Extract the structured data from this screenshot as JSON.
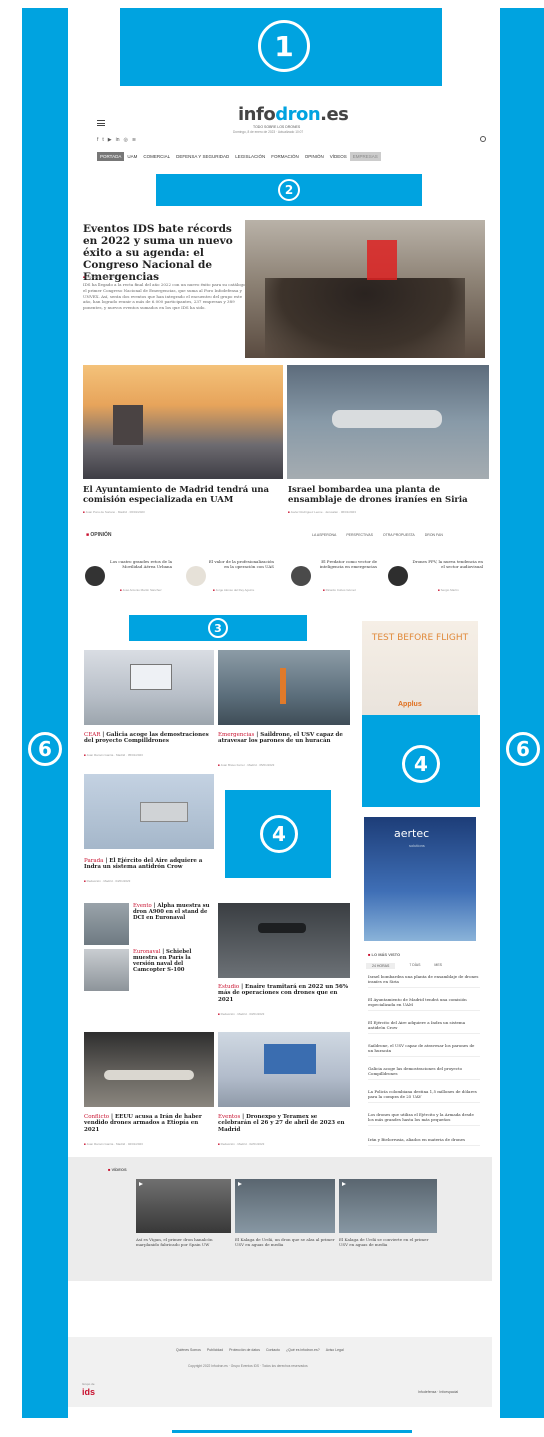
{
  "slots": {
    "top_banner_number": "1",
    "nav_banner_number": "2",
    "mid_banner_number": "3",
    "side_banner_number": "4",
    "center_banner_number": "4",
    "left_skyscraper_number": "6",
    "right_skyscraper_number": "6"
  },
  "header": {
    "logo_part1": "info",
    "logo_part2": "dron",
    "logo_part3": ".es",
    "tagline": "TODO SOBRE LOS DRONES",
    "date_line": "Domingo, 8 de enero de 2023 · Actualizado 10:07"
  },
  "nav": {
    "items": [
      "PORTADA",
      "UAM",
      "COMERCIAL",
      "DEFENSA Y SEGURIDAD",
      "LEGISLACIÓN",
      "FORMACIÓN",
      "OPINIÓN",
      "VÍDEOS",
      "EMPRESAS"
    ]
  },
  "lead": {
    "headline": "Eventos IDS bate récords en 2022 y suma un nuevo éxito a su agenda: el Congreso Nacional de Emergencias",
    "meta": "Redacción · 08/01/2023",
    "summary": "IDS ha llegado a la recta final del año 2022 con un nuevo éxito para su catálogo, el primer Congreso Nacional de Emergencias, que suma al Foro Infodefensa y UNVEX. Así, serán dos eventos que han integrado el encuentro del grupo este año, han logrado reunir a más de 6.000 participantes, 237 empresas y 389 ponentes, y nuevos eventos sumados en los que IDS ha sido."
  },
  "second_row": [
    {
      "headline": "El Ayuntamiento de Madrid tendrá una comisión especializada en UAM",
      "meta": "Juan Pons de Soriano · Madrid · 06/01/2023"
    },
    {
      "headline": "Israel bombardea una planta de ensamblaje de drones iraníes en Siria",
      "meta": "Javier Rodríguez Leone · Jerusalén · 06/01/2023"
    }
  ],
  "opinion": {
    "section_label": "OPINIÓN",
    "tabs": [
      "LA ASPERONA",
      "PERSPECTIVAS",
      "OTRA PROPUESTA",
      "DRON FAN"
    ],
    "items": [
      {
        "title": "Los cuatro grandes retos de la Movilidad Aérea Urbana",
        "author": "José Antonio Martín Sánchez"
      },
      {
        "title": "El valor de la profesionalización en la operación con UAS",
        "author": "Jorge Alonso del Rey Aguirre"
      },
      {
        "title": "El Predator como vector de inteligencia en emergencias",
        "author": "Ricardo Cobos Gómez"
      },
      {
        "title": "Drones FPV, la nueva tendencia en el sector audiovisual",
        "author": "Sergio Martín"
      }
    ]
  },
  "grid": [
    {
      "kicker": "CEAR",
      "headline": "Galicia acoge las demostraciones del proyecto Compilldrones",
      "meta": "Juan Ramón Garcia · Madrid · 05/01/2023"
    },
    {
      "kicker": "Emergencias",
      "headline": "Saildrone, el USV capaz de atravesar los parones de un huracán",
      "meta": "Juan Bravo Ferrer · Madrid · 05/01/2023"
    },
    {
      "kicker": "Parada",
      "headline": "El Ejército del Aire adquiere a Indra un sistema antidrón Crow",
      "meta": "Redacción · Madrid · 04/01/2023"
    },
    {
      "kicker": "Evento",
      "headline": "Alpha muestra su dron A900 en el stand de DCI en Euronaval",
      "meta": ""
    },
    {
      "kicker": "Euronaval",
      "headline": "Schiebel muestra en París la versión naval del Camcopter S-100",
      "meta": ""
    },
    {
      "kicker": "Estudio",
      "headline": "Enaire tramitará en 2022 un 56% más de operaciones con drones que en 2021",
      "meta": "Redacción · Madrid · 03/01/2023"
    },
    {
      "kicker": "Conflicto",
      "headline": "EEUU acusa a Irán de haber vendido drones armados a Etiopía en 2021",
      "meta": "Juan Ramón Garcia · Madrid · 02/01/2023"
    },
    {
      "kicker": "Eventos",
      "headline": "Dronexpo y Teramex se celebrarán el 26 y 27 de abril de 2023 en Madrid",
      "meta": "Redacción · Madrid · 02/01/2023"
    }
  ],
  "sidebar": {
    "ad1_text": "TEST BEFORE FLIGHT",
    "ad1_brand": "Applus",
    "ad2_brand": "aertec",
    "ad2_sub": "solutions",
    "most_viewed_label": "LO MÁS VISTO",
    "most_viewed_tabs": [
      "24 HORAS",
      "7 DÍAS",
      "MES"
    ],
    "most_viewed": [
      "Israel bombardea una planta de ensamblaje de drones iraníes en Siria",
      "El Ayuntamiento de Madrid tendrá una comisión especializada en UAM",
      "El Ejército del Aire adquiere a Indra un sistema antidrón Crow",
      "Saildrone, el USV capaz de atravesar los parones de un huracán",
      "Galicia acoge las demostraciones del proyecto Compilldrones",
      "La Policía colombiana destina 1,5 millones de dólares para la compra de 25 UAV",
      "Los drones que utiliza el Ejército y la Armada desde los más grandes hasta los más pequeños",
      "Irán y Bielorrusia, aliados en materia de drones"
    ]
  },
  "videos": {
    "label": "VÍDEOS",
    "items": [
      "Así es Vigan, el primer dron hanalcón marplanido fabricado por Spain UW",
      "El Kalaga de Urdá, un dron que se alza al primer USV en aguas de media",
      "El Kalaga de Urdá se convierte en el primer USV en aguas de media"
    ]
  },
  "footer": {
    "links": [
      "Quiénes Somos",
      "Publicidad",
      "Protección de datos",
      "Contacto",
      "¿Qué es infodron.es?",
      "Aviso Legal"
    ],
    "copyright": "Copyright 2022 Infodron.es · Grupo Eventos IDS · Todos los derechos reservados",
    "brand": "ids",
    "brand_pre": "Grupo de",
    "partner": "Infodefensa · Infoespacial"
  },
  "colors": {
    "slot_blue": "#00a3e0",
    "accent_red": "#c8102e",
    "logo_blue": "#00a3e0"
  }
}
